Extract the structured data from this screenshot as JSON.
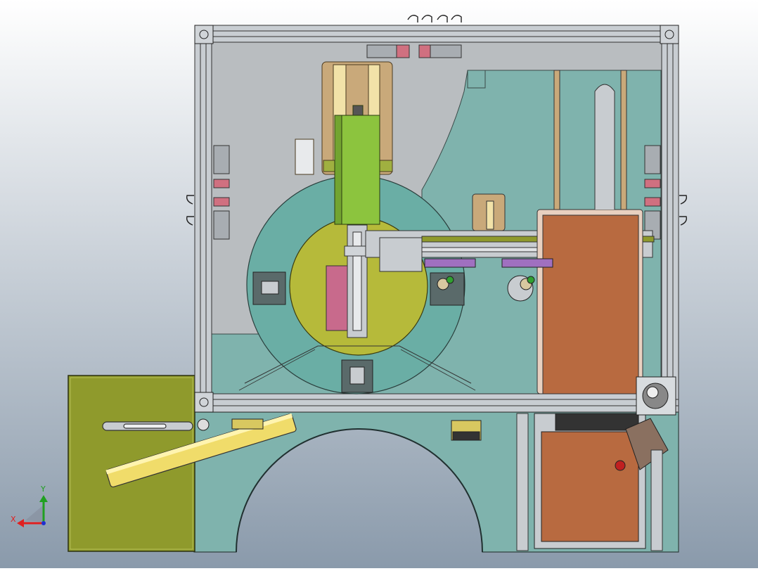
{
  "view": {
    "background_top": "#ffffff",
    "background_bottom": "#8a9aab"
  },
  "triad": {
    "x_label": "X",
    "y_label": "Y",
    "x_color": "#e02020",
    "y_color": "#20a020",
    "z_color": "#2030d0"
  },
  "colors": {
    "frame": "#c8cdd2",
    "enclosure_fill": "#b9bdc0",
    "base_plate": "#7fb3ad",
    "turntable": "#6aaea5",
    "inner_disk": "#b6ba3a",
    "green_block": "#8cc43e",
    "tan_carriage": "#c9a97a",
    "brown_panel": "#b86a40",
    "side_panel": "#8f9a2c",
    "pink_block": "#c86a8c",
    "yellow_bar": "#f0dc6a",
    "purple": "#a070c0"
  }
}
